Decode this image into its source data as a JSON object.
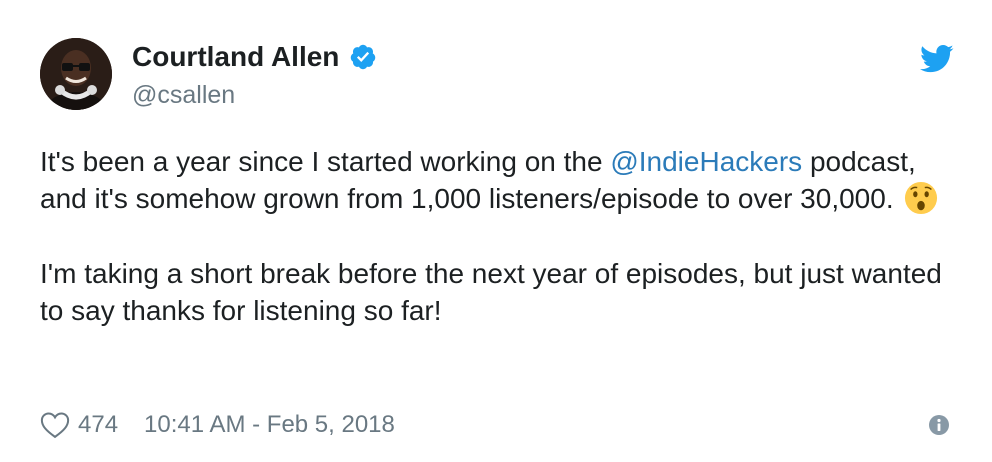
{
  "author": {
    "name": "Courtland Allen",
    "handle": "@csallen",
    "verified": true
  },
  "tweet": {
    "paragraph1_part1": "It's been a year since I started working on the ",
    "mention": "@IndieHackers",
    "paragraph1_part2": " podcast, and it's somehow grown from 1,000 listeners/episode to over 30,000.",
    "paragraph2": "I'm taking a short break before the next year of episodes, but just wanted to say thanks for listening so far!"
  },
  "footer": {
    "likes": "474",
    "timestamp": "10:41 AM - Feb 5, 2018"
  },
  "colors": {
    "link": "#2b7bb9",
    "verified": "#1da1f2",
    "muted": "#697882",
    "text": "#1c2022",
    "twitter_blue": "#1da1f2"
  },
  "icons": [
    "verified-badge-icon",
    "twitter-bird-icon",
    "astonished-face-emoji",
    "heart-icon",
    "info-icon"
  ]
}
